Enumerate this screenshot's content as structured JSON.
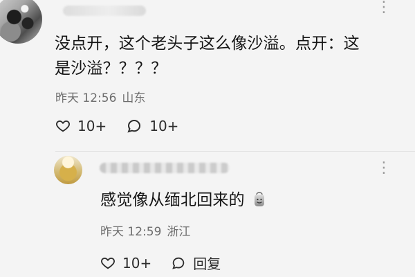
{
  "main_comment": {
    "text_line_1": "没点开，这个老头子这么像沙溢。点开：这",
    "text_line_2": "是沙溢？？？？",
    "time": "昨天 12:56",
    "location": "山东",
    "likes": "10+",
    "replies": "10+"
  },
  "reply_comment": {
    "text": "感觉像从缅北回来的",
    "time": "昨天 12:59",
    "location": "浙江",
    "likes": "10+",
    "reply_label": "回复"
  },
  "icons": {
    "more": "more-icon",
    "heart": "heart-icon",
    "comment": "comment-icon",
    "reply": "reply-icon",
    "emoji": "emoji-bag-icon"
  },
  "colors": {
    "background": "#f4f4f4",
    "text_primary": "#151515",
    "text_secondary": "#6d6d6d",
    "icon": "#2d2d2d"
  }
}
